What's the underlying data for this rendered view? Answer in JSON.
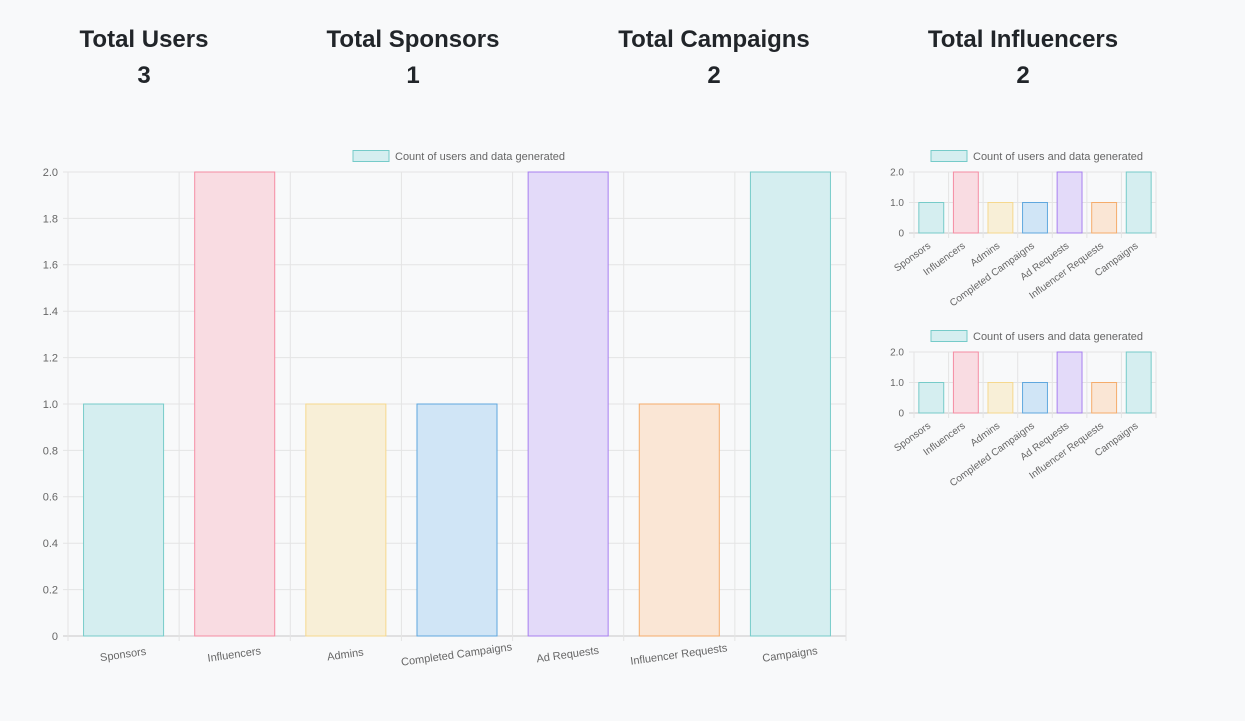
{
  "stats": [
    {
      "title": "Total Users",
      "value": "3"
    },
    {
      "title": "Total Sponsors",
      "value": "1"
    },
    {
      "title": "Total Campaigns",
      "value": "2"
    },
    {
      "title": "Total Influencers",
      "value": "2"
    }
  ],
  "chart_data": [
    {
      "type": "bar",
      "legend": "Count of users and data generated",
      "legend_position": "top",
      "categories": [
        "Sponsors",
        "Influencers",
        "Admins",
        "Completed Campaigns",
        "Ad Requests",
        "Influencer Requests",
        "Campaigns"
      ],
      "values": [
        1,
        2,
        1,
        1,
        2,
        1,
        2
      ],
      "ylim": [
        0,
        2
      ],
      "yticks": [
        "0",
        "0.2",
        "0.4",
        "0.6",
        "0.8",
        "1.0",
        "1.2",
        "1.4",
        "1.6",
        "1.8",
        "2.0"
      ],
      "grid": true,
      "bar_fill_colors": [
        "#d5eef0",
        "#f9dce2",
        "#f8efd7",
        "#d0e5f6",
        "#e3daf9",
        "#fae6d5",
        "#d5eef0"
      ],
      "bar_border_colors": [
        "#76cbc9",
        "#f58ca3",
        "#f6d88d",
        "#5fa7de",
        "#a77ff0",
        "#f5ac6b",
        "#76cbc9"
      ]
    },
    {
      "type": "bar",
      "legend": "Count of users and data generated",
      "legend_position": "top",
      "categories": [
        "Sponsors",
        "Influencers",
        "Admins",
        "Completed Campaigns",
        "Ad Requests",
        "Influencer Requests",
        "Campaigns"
      ],
      "values": [
        1,
        2,
        1,
        1,
        2,
        1,
        2
      ],
      "ylim": [
        0,
        2
      ],
      "yticks": [
        "0",
        "1.0",
        "2.0"
      ],
      "grid": true,
      "bar_fill_colors": [
        "#d5eef0",
        "#f9dce2",
        "#f8efd7",
        "#d0e5f6",
        "#e3daf9",
        "#fae6d5",
        "#d5eef0"
      ],
      "bar_border_colors": [
        "#76cbc9",
        "#f58ca3",
        "#f6d88d",
        "#5fa7de",
        "#a77ff0",
        "#f5ac6b",
        "#76cbc9"
      ]
    },
    {
      "type": "bar",
      "legend": "Count of users and data generated",
      "legend_position": "top",
      "categories": [
        "Sponsors",
        "Influencers",
        "Admins",
        "Completed Campaigns",
        "Ad Requests",
        "Influencer Requests",
        "Campaigns"
      ],
      "values": [
        1,
        2,
        1,
        1,
        2,
        1,
        2
      ],
      "ylim": [
        0,
        2
      ],
      "yticks": [
        "0",
        "1.0",
        "2.0"
      ],
      "grid": true,
      "bar_fill_colors": [
        "#d5eef0",
        "#f9dce2",
        "#f8efd7",
        "#d0e5f6",
        "#e3daf9",
        "#fae6d5",
        "#d5eef0"
      ],
      "bar_border_colors": [
        "#76cbc9",
        "#f58ca3",
        "#f6d88d",
        "#5fa7de",
        "#a77ff0",
        "#f5ac6b",
        "#76cbc9"
      ]
    }
  ]
}
